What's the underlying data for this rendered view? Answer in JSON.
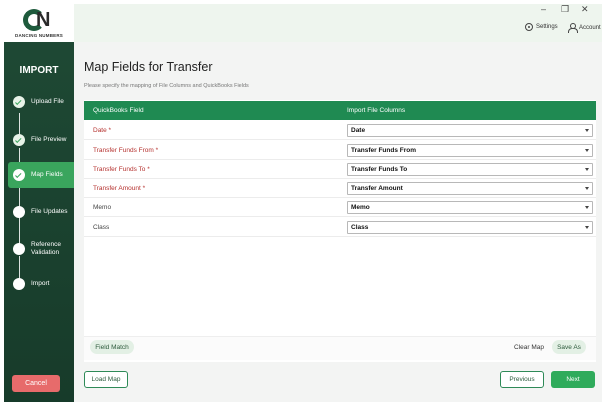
{
  "app": {
    "logo_letters": "N",
    "logo_text": "DANCING NUMBERS"
  },
  "window_controls": {
    "minimize": "–",
    "restore": "❐",
    "close": "✕"
  },
  "topbar": {
    "settings_label": "Settings",
    "account_label": "Account"
  },
  "sidebar": {
    "title": "IMPORT",
    "steps": [
      {
        "label": "Upload File",
        "status": "done"
      },
      {
        "label": "File Preview",
        "status": "done"
      },
      {
        "label": "Map Fields",
        "status": "active"
      },
      {
        "label": "File Updates",
        "status": "todo"
      },
      {
        "label": "Reference\nValidation",
        "status": "todo"
      },
      {
        "label": "Import",
        "status": "todo"
      }
    ],
    "cancel_label": "Cancel"
  },
  "page": {
    "title": "Map Fields for Transfer",
    "subtitle": "Please specify the mapping of File Columns and QuickBooks Fields"
  },
  "table": {
    "headers": [
      "QuickBooks Field",
      "Import File Columns"
    ],
    "rows": [
      {
        "field": "Date *",
        "required": true,
        "value": "Date"
      },
      {
        "field": "Transfer Funds From *",
        "required": true,
        "value": "Transfer Funds From"
      },
      {
        "field": "Transfer Funds To *",
        "required": true,
        "value": "Transfer Funds To"
      },
      {
        "field": "Transfer Amount *",
        "required": true,
        "value": "Transfer Amount"
      },
      {
        "field": "Memo",
        "required": false,
        "value": "Memo"
      },
      {
        "field": "Class",
        "required": false,
        "value": "Class"
      }
    ]
  },
  "panel_actions": {
    "field_match": "Field Match",
    "clear_map": "Clear Map",
    "save_as": "Save As"
  },
  "footer": {
    "load_map": "Load Map",
    "previous": "Previous",
    "next": "Next"
  },
  "colors": {
    "sidebar": "#1f4a35",
    "accent_green": "#1f8a52",
    "active_step": "#3aa55d",
    "required_text": "#b5312e",
    "cancel": "#e76b6b"
  }
}
